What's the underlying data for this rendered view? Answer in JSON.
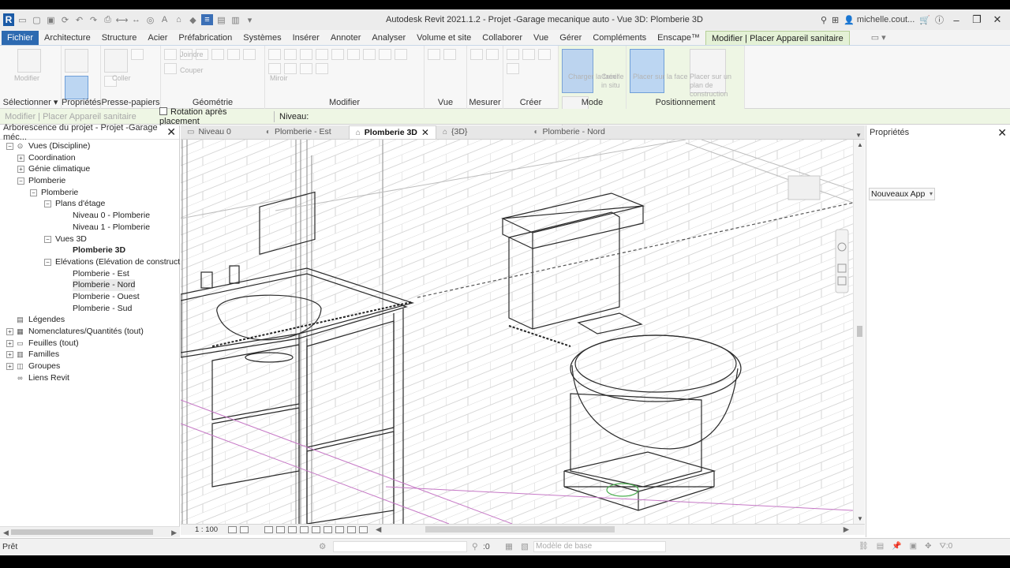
{
  "window": {
    "title": "Autodesk Revit 2021.1.2 - Projet -Garage mecanique auto - Vue 3D: Plomberie 3D",
    "user": "michelle.cout...",
    "app_logo": "R"
  },
  "ribbon_tabs": [
    "Fichier",
    "Architecture",
    "Structure",
    "Acier",
    "Préfabrication",
    "Systèmes",
    "Insérer",
    "Annoter",
    "Analyser",
    "Volume et site",
    "Collaborer",
    "Vue",
    "Gérer",
    "Compléments",
    "Enscape™",
    "Modifier | Placer Appareil sanitaire"
  ],
  "ribbon_panels": {
    "selectionner": "Sélectionner",
    "proprietes": "Propriétés",
    "presse_papiers": "Presse-papiers",
    "geometrie": "Géométrie",
    "modifier": "Modifier",
    "vue": "Vue",
    "mesurer": "Mesurer",
    "creer": "Créer",
    "mode": "Mode",
    "positionnement": "Positionnement",
    "modifier_btn": "Modifier",
    "coller": "Coller",
    "joindre": "Joindre",
    "couper": "Couper",
    "mirror": "Miroir",
    "charger_famille": "Charger\nla famille",
    "creer_in_place": "Créer\nin situ",
    "placer_sur_face": "Placer\nsur la face",
    "placer_plan": "Placer sur\nun plan de construction"
  },
  "options_bar": {
    "context_label": "Modifier | Placer Appareil sanitaire",
    "rotation_label": "Rotation après placement",
    "level_label": "Niveau:"
  },
  "project_browser": {
    "title": "Arborescence du projet - Projet -Garage méc...",
    "nodes": [
      {
        "label": "Vues (Discipline)",
        "level": 0,
        "toggle": "−",
        "icon": "views"
      },
      {
        "label": "Coordination",
        "level": 1,
        "toggle": "+"
      },
      {
        "label": "Génie climatique",
        "level": 1,
        "toggle": "+"
      },
      {
        "label": "Plomberie",
        "level": 1,
        "toggle": "−"
      },
      {
        "label": "Plomberie",
        "level": 2,
        "toggle": "−"
      },
      {
        "label": "Plans d'étage",
        "level": 3,
        "toggle": "−"
      },
      {
        "label": "Niveau 0 - Plomberie",
        "level": 4
      },
      {
        "label": "Niveau 1 - Plomberie",
        "level": 4
      },
      {
        "label": "Vues 3D",
        "level": 3,
        "toggle": "−"
      },
      {
        "label": "Plomberie 3D",
        "level": 4,
        "bold": true
      },
      {
        "label": "Elévations (Elévation de construct",
        "level": 3,
        "toggle": "−"
      },
      {
        "label": "Plomberie - Est",
        "level": 4
      },
      {
        "label": "Plomberie - Nord",
        "level": 4,
        "selected": true
      },
      {
        "label": "Plomberie - Ouest",
        "level": 4
      },
      {
        "label": "Plomberie - Sud",
        "level": 4
      },
      {
        "label": "Légendes",
        "level": 0,
        "icon": "legend"
      },
      {
        "label": "Nomenclatures/Quantités (tout)",
        "level": 0,
        "toggle": "+",
        "icon": "schedule"
      },
      {
        "label": "Feuilles (tout)",
        "level": 0,
        "toggle": "+",
        "icon": "sheet"
      },
      {
        "label": "Familles",
        "level": 0,
        "toggle": "+",
        "icon": "family"
      },
      {
        "label": "Groupes",
        "level": 0,
        "toggle": "+",
        "icon": "group"
      },
      {
        "label": "Liens Revit",
        "level": 0,
        "icon": "link"
      }
    ]
  },
  "view_tabs": [
    {
      "label": "Niveau 0",
      "active": false
    },
    {
      "label": "Plomberie - Est",
      "active": false
    },
    {
      "label": "Plomberie 3D",
      "active": true
    },
    {
      "label": "{3D}",
      "active": false
    },
    {
      "label": "Plomberie - Nord",
      "active": false
    }
  ],
  "view_control": {
    "scale": "1 : 100"
  },
  "properties": {
    "title": "Propriétés",
    "type_selector": "Nouveaux App"
  },
  "status": {
    "text": "Prêt",
    "selection_count": ":0",
    "model": "Modèle de base",
    "filter_count": ":0"
  },
  "colors": {
    "file_tab": "#2d6ab1",
    "context_tab": "#e4f1d6",
    "selected_mode": "#bcd4ef"
  }
}
